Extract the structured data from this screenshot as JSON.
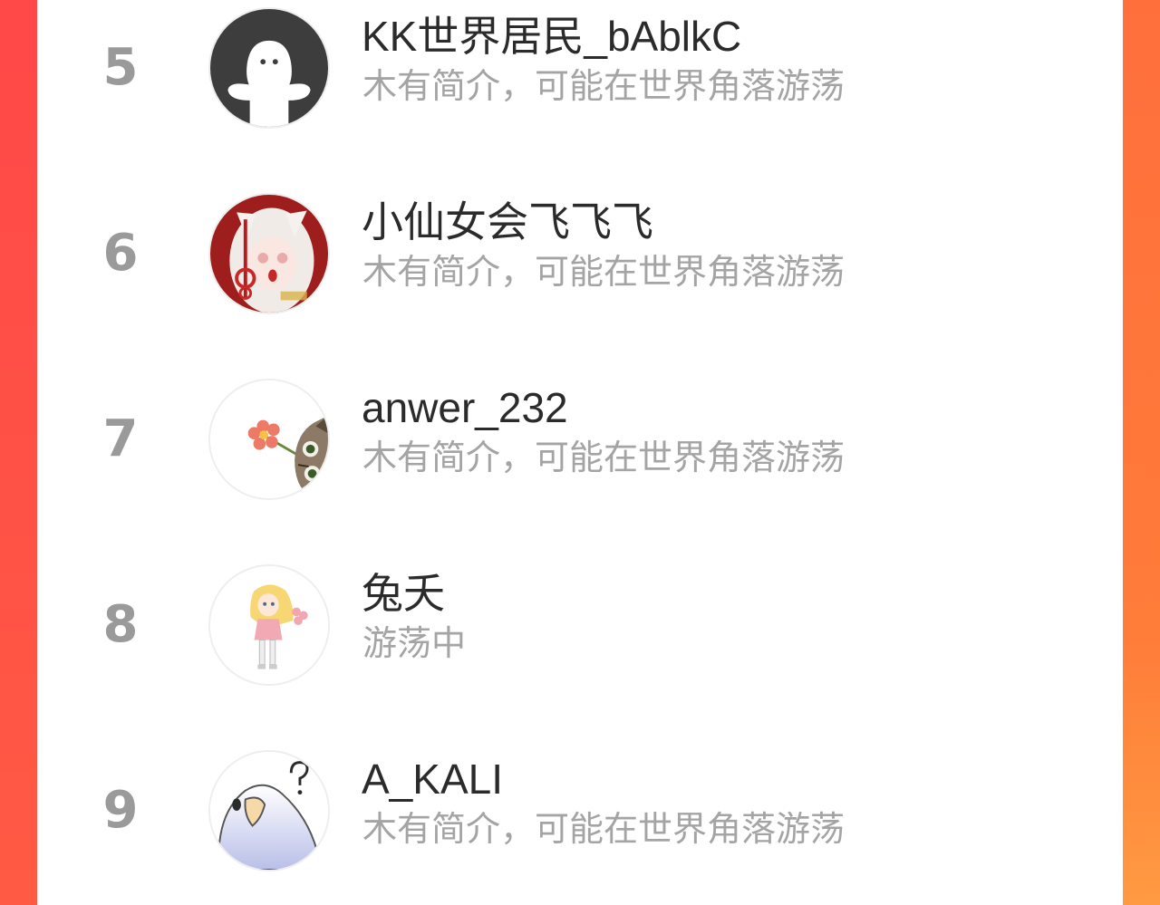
{
  "rank_list": [
    {
      "rank": "5",
      "name": "KK世界居民_bAblkC",
      "bio": "木有简介，可能在世界角落游荡",
      "avatar_icon": "ghost-avatar"
    },
    {
      "rank": "6",
      "name": "小仙女会飞飞飞",
      "bio": "木有简介，可能在世界角落游荡",
      "avatar_icon": "anime-girl-avatar"
    },
    {
      "rank": "7",
      "name": "anwer_232",
      "bio": "木有简介，可能在世界角落游荡",
      "avatar_icon": "cat-flower-avatar"
    },
    {
      "rank": "8",
      "name": "兔夭",
      "bio": "游荡中",
      "avatar_icon": "girl-illustration-avatar"
    },
    {
      "rank": "9",
      "name": "A_KALI",
      "bio": "木有简介，可能在世界角落游荡",
      "avatar_icon": "bird-avatar"
    }
  ],
  "colors": {
    "background_red": "#ff4d4a",
    "background_orange": "#ff8a3a",
    "rank_gray": "#9a9a9a",
    "name_text": "#2b2b2b",
    "bio_text": "#a4a4a4"
  }
}
